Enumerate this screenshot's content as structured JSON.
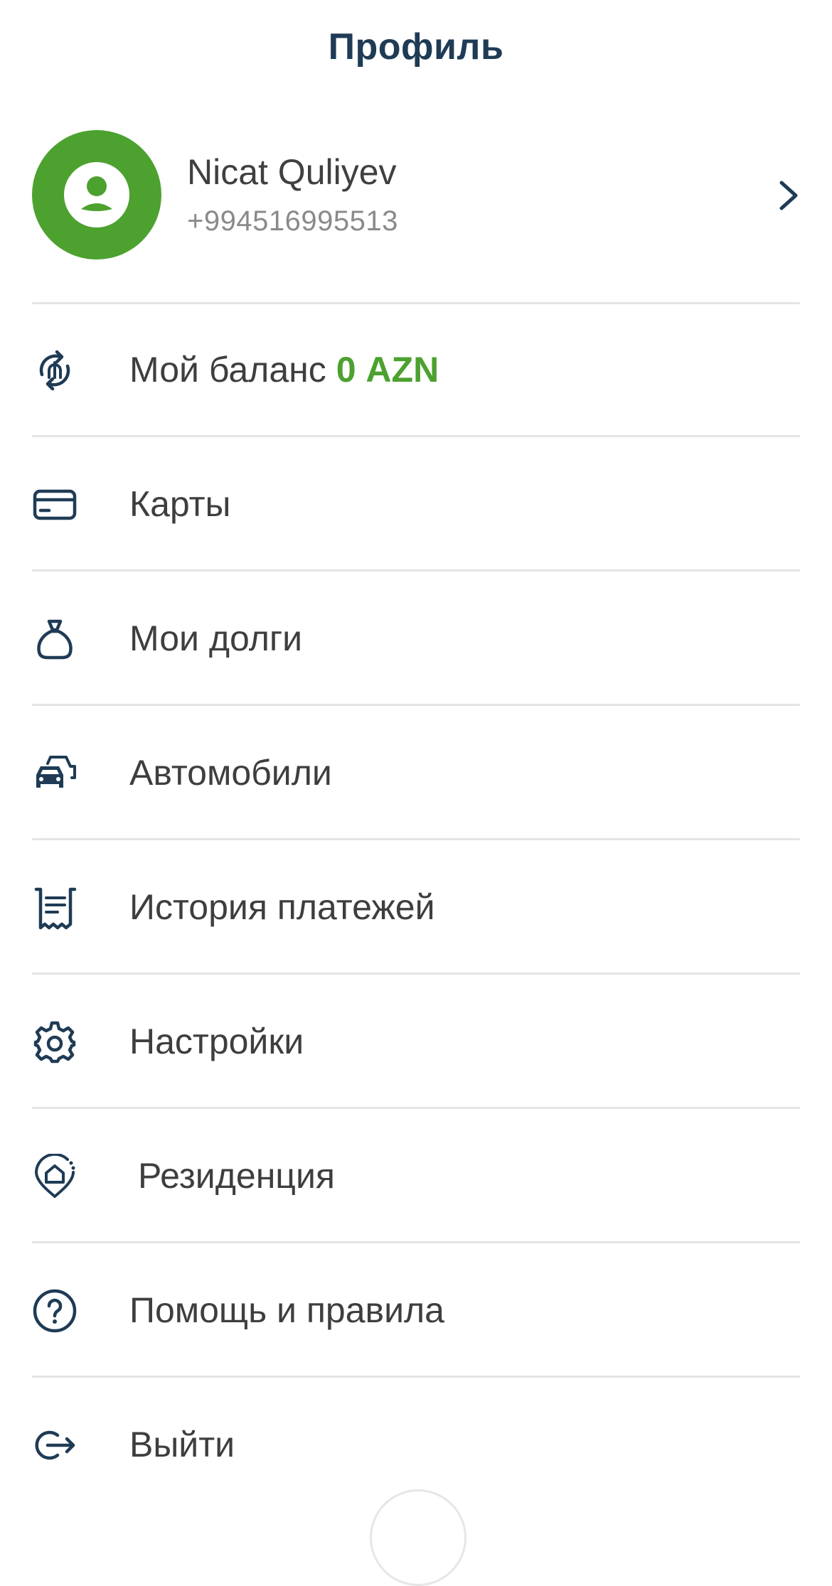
{
  "header": {
    "title": "Профиль"
  },
  "profile": {
    "name": "Nicat Quliyev",
    "phone": "+994516995513",
    "avatar_icon": "user-circle-icon",
    "avatar_color": "#4ca12f"
  },
  "menu": {
    "items": [
      {
        "label": "Мой баланс",
        "value": "0 AZN",
        "icon": "balance-exchange-icon"
      },
      {
        "label": "Карты",
        "icon": "card-icon"
      },
      {
        "label": "Мои долги",
        "icon": "money-bag-icon"
      },
      {
        "label": "Автомобили",
        "icon": "cars-icon"
      },
      {
        "label": "История платежей",
        "icon": "receipt-icon"
      },
      {
        "label": "Настройки",
        "icon": "gear-icon"
      },
      {
        "label": "Резиденция",
        "icon": "home-location-icon"
      },
      {
        "label": "Помощь и правила",
        "icon": "help-icon"
      },
      {
        "label": "Выйти",
        "icon": "logout-icon"
      }
    ]
  },
  "colors": {
    "accent": "#4ca12f",
    "title": "#1f3b55",
    "icon": "#1f3b55",
    "text": "#3e3e3e",
    "muted": "#8a8a8a",
    "divider": "#e4e4e4"
  }
}
